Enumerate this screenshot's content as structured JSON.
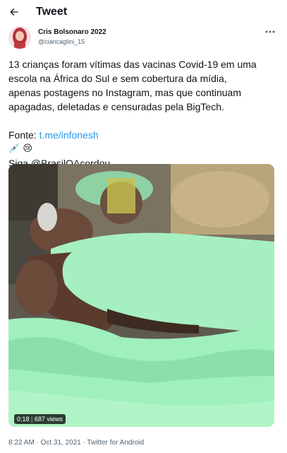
{
  "header": {
    "title": "Tweet"
  },
  "author": {
    "name": "Cris Bolsonaro 2022",
    "handle": "@ciancaglini_15"
  },
  "tweet": {
    "line1": "13 crianças foram vítimas das vacinas Covid-19 em uma",
    "line2": "escola na África do Sul e sem cobertura da mídia,",
    "line3": "apenas postagens no Instagram, mas que continuam",
    "line4": "apagadas, deletadas e censuradas pela BigTech.",
    "source_label": "Fonte: ",
    "source_link": "t.me/infonesh",
    "emoji_line": "💉 😢",
    "follow": "Siga @BrasilQAcordou"
  },
  "video": {
    "time": "0:18",
    "views": "687 views"
  },
  "meta": "8:22 AM · Oct 31, 2021 · Twitter for Android",
  "icons": {
    "back": "arrow-left-icon",
    "more": "more-horizontal-icon"
  }
}
